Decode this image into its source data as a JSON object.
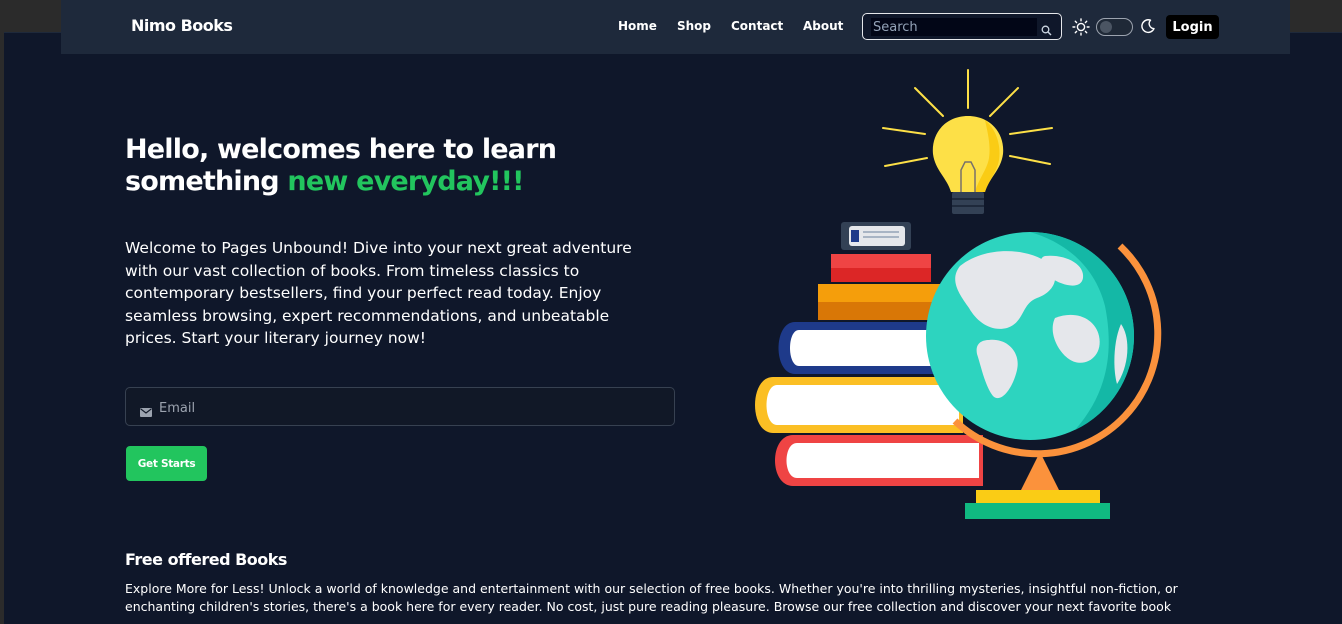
{
  "brand": "Nimo Books",
  "nav": {
    "links": [
      "Home",
      "Shop",
      "Contact",
      "About"
    ],
    "search_placeholder": "Search",
    "login_label": "Login"
  },
  "hero": {
    "title_line1": "Hello, welcomes here to learn",
    "title_line2_plain": "something ",
    "title_line2_accent": "new everyday!!!",
    "description": "Welcome to Pages Unbound! Dive into your next great adventure with our vast collection of books. From timeless classics to contemporary bestsellers, find your perfect read today. Enjoy seamless browsing, expert recommendations, and unbeatable prices. Start your literary journey now!",
    "email_placeholder": "Email",
    "cta_label": "Get Starts"
  },
  "free_section": {
    "title": "Free offered Books",
    "text": "Explore More for Less! Unlock a world of knowledge and entertainment with our selection of free books. Whether you're into thrilling mysteries, insightful non-fiction, or enchanting children's stories, there's a book here for every reader. No cost, just pure reading pleasure. Browse our free collection and discover your next favorite book"
  },
  "theme": {
    "accent": "#22c55e",
    "background": "#0f172a",
    "navbar": "#1e293b"
  },
  "icons": [
    "search-icon",
    "sun-icon",
    "moon-icon",
    "mail-icon",
    "lightbulb-icon",
    "globe-icon",
    "books-icon"
  ]
}
